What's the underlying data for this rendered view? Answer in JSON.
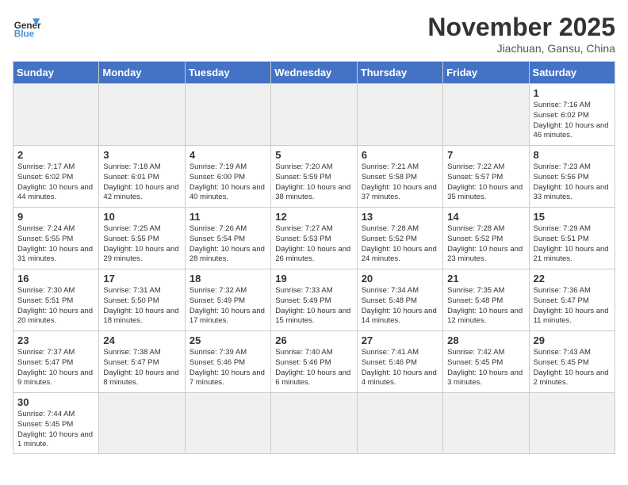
{
  "header": {
    "logo_general": "General",
    "logo_blue": "Blue",
    "month_title": "November 2025",
    "subtitle": "Jiachuan, Gansu, China"
  },
  "days_of_week": [
    "Sunday",
    "Monday",
    "Tuesday",
    "Wednesday",
    "Thursday",
    "Friday",
    "Saturday"
  ],
  "weeks": [
    [
      {
        "day": "",
        "info": ""
      },
      {
        "day": "",
        "info": ""
      },
      {
        "day": "",
        "info": ""
      },
      {
        "day": "",
        "info": ""
      },
      {
        "day": "",
        "info": ""
      },
      {
        "day": "",
        "info": ""
      },
      {
        "day": "1",
        "info": "Sunrise: 7:16 AM\nSunset: 6:02 PM\nDaylight: 10 hours and 46 minutes."
      }
    ],
    [
      {
        "day": "2",
        "info": "Sunrise: 7:17 AM\nSunset: 6:02 PM\nDaylight: 10 hours and 44 minutes."
      },
      {
        "day": "3",
        "info": "Sunrise: 7:18 AM\nSunset: 6:01 PM\nDaylight: 10 hours and 42 minutes."
      },
      {
        "day": "4",
        "info": "Sunrise: 7:19 AM\nSunset: 6:00 PM\nDaylight: 10 hours and 40 minutes."
      },
      {
        "day": "5",
        "info": "Sunrise: 7:20 AM\nSunset: 5:59 PM\nDaylight: 10 hours and 38 minutes."
      },
      {
        "day": "6",
        "info": "Sunrise: 7:21 AM\nSunset: 5:58 PM\nDaylight: 10 hours and 37 minutes."
      },
      {
        "day": "7",
        "info": "Sunrise: 7:22 AM\nSunset: 5:57 PM\nDaylight: 10 hours and 35 minutes."
      },
      {
        "day": "8",
        "info": "Sunrise: 7:23 AM\nSunset: 5:56 PM\nDaylight: 10 hours and 33 minutes."
      }
    ],
    [
      {
        "day": "9",
        "info": "Sunrise: 7:24 AM\nSunset: 5:55 PM\nDaylight: 10 hours and 31 minutes."
      },
      {
        "day": "10",
        "info": "Sunrise: 7:25 AM\nSunset: 5:55 PM\nDaylight: 10 hours and 29 minutes."
      },
      {
        "day": "11",
        "info": "Sunrise: 7:26 AM\nSunset: 5:54 PM\nDaylight: 10 hours and 28 minutes."
      },
      {
        "day": "12",
        "info": "Sunrise: 7:27 AM\nSunset: 5:53 PM\nDaylight: 10 hours and 26 minutes."
      },
      {
        "day": "13",
        "info": "Sunrise: 7:28 AM\nSunset: 5:52 PM\nDaylight: 10 hours and 24 minutes."
      },
      {
        "day": "14",
        "info": "Sunrise: 7:28 AM\nSunset: 5:52 PM\nDaylight: 10 hours and 23 minutes."
      },
      {
        "day": "15",
        "info": "Sunrise: 7:29 AM\nSunset: 5:51 PM\nDaylight: 10 hours and 21 minutes."
      }
    ],
    [
      {
        "day": "16",
        "info": "Sunrise: 7:30 AM\nSunset: 5:51 PM\nDaylight: 10 hours and 20 minutes."
      },
      {
        "day": "17",
        "info": "Sunrise: 7:31 AM\nSunset: 5:50 PM\nDaylight: 10 hours and 18 minutes."
      },
      {
        "day": "18",
        "info": "Sunrise: 7:32 AM\nSunset: 5:49 PM\nDaylight: 10 hours and 17 minutes."
      },
      {
        "day": "19",
        "info": "Sunrise: 7:33 AM\nSunset: 5:49 PM\nDaylight: 10 hours and 15 minutes."
      },
      {
        "day": "20",
        "info": "Sunrise: 7:34 AM\nSunset: 5:48 PM\nDaylight: 10 hours and 14 minutes."
      },
      {
        "day": "21",
        "info": "Sunrise: 7:35 AM\nSunset: 5:48 PM\nDaylight: 10 hours and 12 minutes."
      },
      {
        "day": "22",
        "info": "Sunrise: 7:36 AM\nSunset: 5:47 PM\nDaylight: 10 hours and 11 minutes."
      }
    ],
    [
      {
        "day": "23",
        "info": "Sunrise: 7:37 AM\nSunset: 5:47 PM\nDaylight: 10 hours and 9 minutes."
      },
      {
        "day": "24",
        "info": "Sunrise: 7:38 AM\nSunset: 5:47 PM\nDaylight: 10 hours and 8 minutes."
      },
      {
        "day": "25",
        "info": "Sunrise: 7:39 AM\nSunset: 5:46 PM\nDaylight: 10 hours and 7 minutes."
      },
      {
        "day": "26",
        "info": "Sunrise: 7:40 AM\nSunset: 5:46 PM\nDaylight: 10 hours and 6 minutes."
      },
      {
        "day": "27",
        "info": "Sunrise: 7:41 AM\nSunset: 5:46 PM\nDaylight: 10 hours and 4 minutes."
      },
      {
        "day": "28",
        "info": "Sunrise: 7:42 AM\nSunset: 5:45 PM\nDaylight: 10 hours and 3 minutes."
      },
      {
        "day": "29",
        "info": "Sunrise: 7:43 AM\nSunset: 5:45 PM\nDaylight: 10 hours and 2 minutes."
      }
    ],
    [
      {
        "day": "30",
        "info": "Sunrise: 7:44 AM\nSunset: 5:45 PM\nDaylight: 10 hours and 1 minute."
      },
      {
        "day": "",
        "info": ""
      },
      {
        "day": "",
        "info": ""
      },
      {
        "day": "",
        "info": ""
      },
      {
        "day": "",
        "info": ""
      },
      {
        "day": "",
        "info": ""
      },
      {
        "day": "",
        "info": ""
      }
    ]
  ]
}
